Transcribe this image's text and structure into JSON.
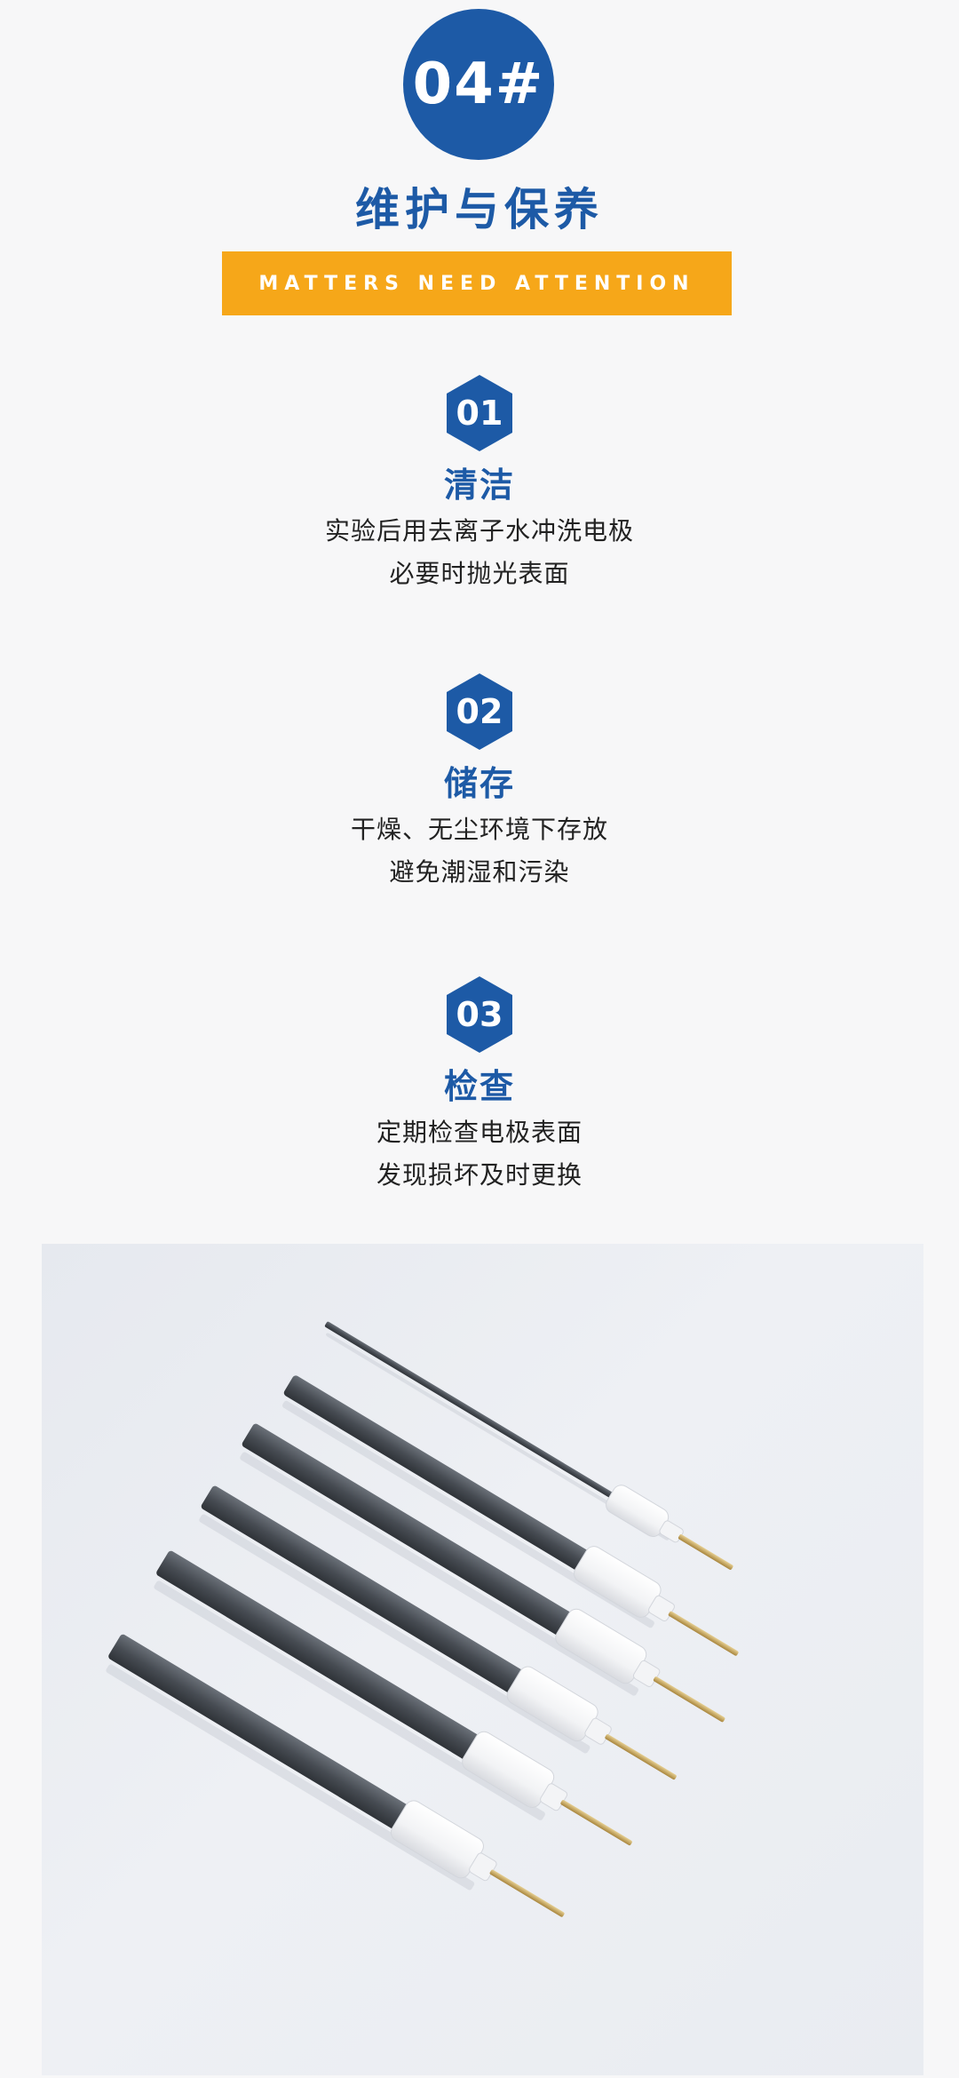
{
  "badge": {
    "number": "04#"
  },
  "title": "维护与保养",
  "banner": "MATTERS NEED ATTENTION",
  "items": [
    {
      "num": "01",
      "title": "清洁",
      "lines": [
        "实验后用去离子水冲洗电极",
        "必要时抛光表面"
      ]
    },
    {
      "num": "02",
      "title": "储存",
      "lines": [
        "干燥、无尘环境下存放",
        "避免潮湿和污染"
      ]
    },
    {
      "num": "03",
      "title": "检查",
      "lines": [
        "定期检查电极表面",
        "发现损坏及时更换"
      ]
    }
  ],
  "colors": {
    "primary_blue": "#1d5aa6",
    "banner_orange": "#f6a719",
    "background": "#f7f7f8",
    "rod_graphite": "#4a4f56",
    "sleeve_white": "#fbfbfb",
    "pin_brass": "#c9a55a"
  },
  "photo": {
    "subject": "graphite-rod-electrodes",
    "count": 6
  }
}
